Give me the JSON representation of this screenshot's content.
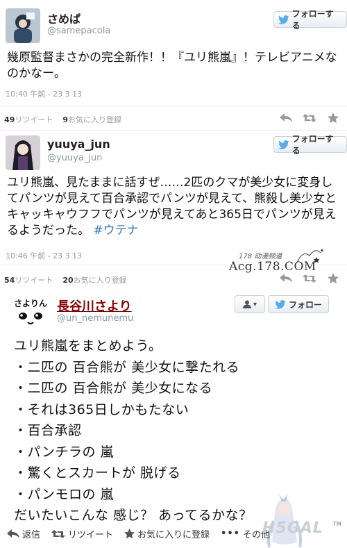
{
  "tweets": [
    {
      "username": "さめぱ",
      "handle": "@samepacola",
      "follow_label": "フォローする",
      "text": "幾原監督まさかの完全新作！！『ユリ熊嵐』！テレビアニメなのかなー。",
      "time": "10:40 午前 - 23 3 13",
      "retweets": "49",
      "retweets_label": "リツイート",
      "favorites": "9",
      "favorites_label": "お気に入り登録"
    },
    {
      "username": "yuuya_jun",
      "handle": "@yuuya_jun",
      "follow_label": "フォローする",
      "text_main": "ユリ熊嵐、見たままに話すぜ……2匹のクマが美少女に変身してパンツが見えて百合承認でパンツが見えて、熊殺し美少女とキャッキャウフフでパンツが見えてあと365日でパンツが見えるようだった。",
      "hashtag": "#ウテナ",
      "time": "10:46 午前 - 23 3 13",
      "retweets": "54",
      "retweets_label": "リツイート",
      "favorites": "20",
      "favorites_label": "お気に入り登録"
    },
    {
      "username": "長谷川さより",
      "handle": "@un_nemunemu",
      "avatar_text": "さよりん",
      "follow_label": "フォロー",
      "lines": [
        "ユリ熊嵐をまとめよう。",
        "・二匹の 百合熊が 美少女に撃たれる",
        "・二匹の 百合熊が 美少女になる",
        "・それは365日しかもたない",
        "・百合承認",
        "・パンチラの 嵐",
        "・驚くとスカートが 脱げる",
        "・パンモロの 嵐",
        "だいたいこんな 感じ？ あってるかな？"
      ],
      "actions": {
        "reply": "返信",
        "retweet": "リツイート",
        "favorite": "お気に入りに登録",
        "more": "その他"
      }
    }
  ],
  "watermark": {
    "line1": "178 动漫频道",
    "line2": "Acg.178.COM"
  },
  "h5_logo": "H5GAL",
  "tm": "TM",
  "colors": {
    "bird": "#55acee",
    "hashtag": "#2b7bb9",
    "sayori_name": "#8b0000"
  }
}
